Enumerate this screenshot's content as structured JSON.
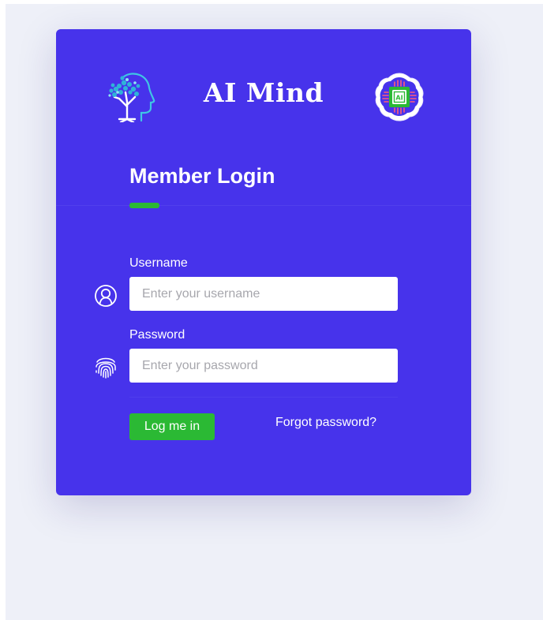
{
  "brand": {
    "title": "AI Mind",
    "left_logo_icon": "tree-head-icon",
    "right_logo_icon": "ai-chip-brain-icon"
  },
  "login": {
    "title": "Member Login",
    "username": {
      "label": "Username",
      "value": "",
      "placeholder": "Enter your username",
      "icon": "user-icon"
    },
    "password": {
      "label": "Password",
      "value": "",
      "placeholder": "Enter your password",
      "icon": "fingerprint-icon"
    },
    "submit_label": "Log me in",
    "forgot_label": "Forgot password?"
  },
  "colors": {
    "page_background": "#eef0f8",
    "card_background": "#4733eb",
    "accent_green": "#2bb934",
    "text": "#ffffff",
    "input_background": "#ffffff",
    "placeholder": "#a7a7ad"
  }
}
